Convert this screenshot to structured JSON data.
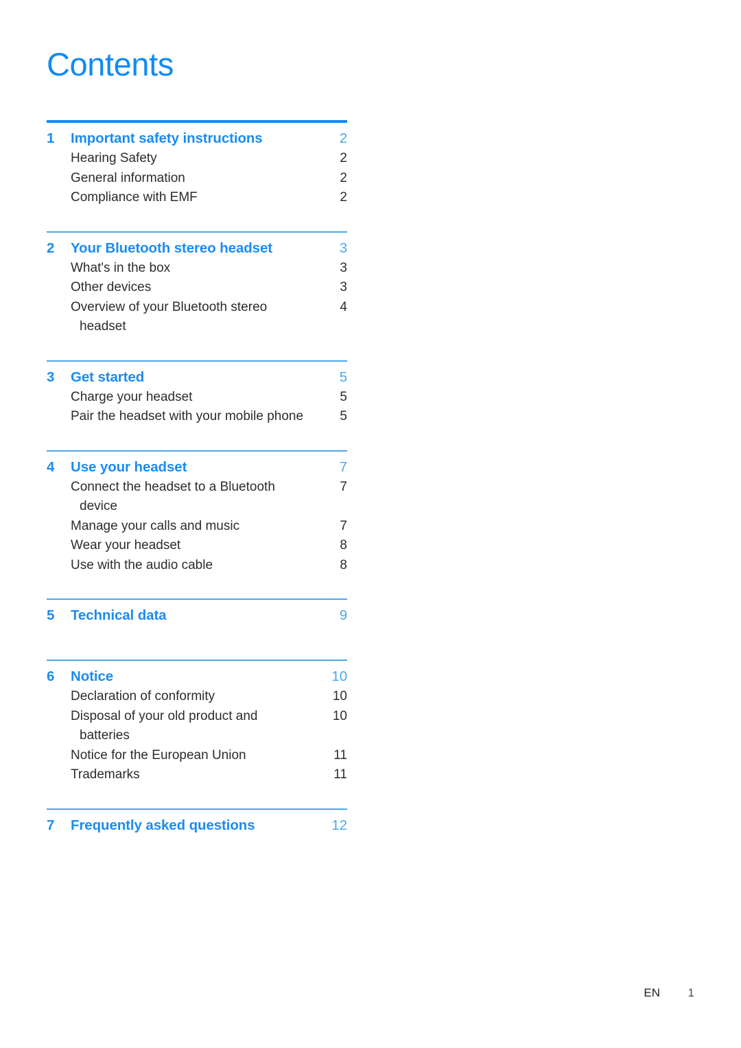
{
  "document": {
    "title": "Contents",
    "accent_color": "#0f8bf5",
    "rule_color": "#4aa8e8",
    "rule_color_primary": "#0d8cf5",
    "body_text_color": "#2c2c2c"
  },
  "toc": {
    "sections": [
      {
        "number": "1",
        "label": "Important safety instructions",
        "page": "2",
        "items": [
          {
            "label": "Hearing Safety",
            "cont": "",
            "page": "2"
          },
          {
            "label": "General information",
            "cont": "",
            "page": "2"
          },
          {
            "label": "Compliance with EMF",
            "cont": "",
            "page": "2"
          }
        ]
      },
      {
        "number": "2",
        "label": "Your Bluetooth stereo headset",
        "page": "3",
        "items": [
          {
            "label": "What's in the box",
            "cont": "",
            "page": "3"
          },
          {
            "label": "Other devices",
            "cont": "",
            "page": "3"
          },
          {
            "label": "Overview of your Bluetooth stereo",
            "cont": "headset",
            "page": "4"
          }
        ]
      },
      {
        "number": "3",
        "label": "Get started",
        "page": "5",
        "items": [
          {
            "label": "Charge your headset",
            "cont": "",
            "page": "5"
          },
          {
            "label": "Pair the headset with your mobile phone",
            "cont": "",
            "page": "5"
          }
        ]
      },
      {
        "number": "4",
        "label": "Use your headset",
        "page": "7",
        "items": [
          {
            "label": "Connect the headset to a Bluetooth",
            "cont": "device",
            "page": "7"
          },
          {
            "label": "Manage your calls and music",
            "cont": "",
            "page": "7"
          },
          {
            "label": "Wear your headset",
            "cont": "",
            "page": "8"
          },
          {
            "label": "Use with the audio cable",
            "cont": "",
            "page": "8"
          }
        ]
      },
      {
        "number": "5",
        "label": "Technical data",
        "page": "9",
        "items": []
      },
      {
        "number": "6",
        "label": "Notice",
        "page": "10",
        "items": [
          {
            "label": "Declaration of conformity",
            "cont": "",
            "page": "10"
          },
          {
            "label": "Disposal of your old product and",
            "cont": "batteries",
            "page": "10"
          },
          {
            "label": "Notice for the European Union",
            "cont": "",
            "page": "11"
          },
          {
            "label": "Trademarks",
            "cont": "",
            "page": "11"
          }
        ]
      },
      {
        "number": "7",
        "label": "Frequently asked questions",
        "page": "12",
        "items": []
      }
    ]
  },
  "footer": {
    "language": "EN",
    "page_number": "1"
  }
}
